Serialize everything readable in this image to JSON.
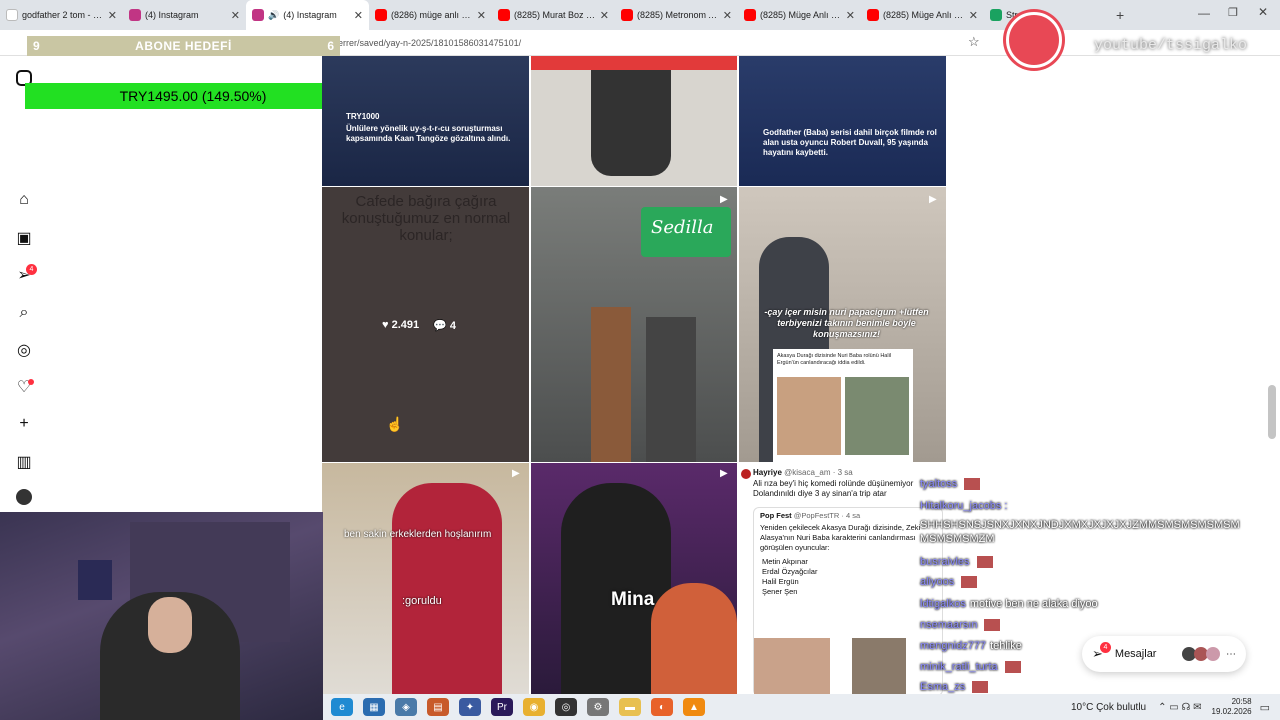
{
  "tabs": [
    {
      "title": "godfather 2 tom - Goog",
      "color": "#ffffff"
    },
    {
      "title": "(4) Instagram",
      "color": "#c13584"
    },
    {
      "title": "(4) Instagram",
      "color": "#c13584",
      "active": true
    },
    {
      "title": "(8286) müge anlı - YouTu",
      "color": "#ff0000"
    },
    {
      "title": "(8285) Murat Boz - Uçur",
      "color": "#ff0000"
    },
    {
      "title": "(8285) Metronom Akadı",
      "color": "#ff0000"
    },
    {
      "title": "(8285) Müge Anlı ile Tatl",
      "color": "#ff0000"
    },
    {
      "title": "(8285) Müge Anlı ile Tat",
      "color": "#ff0000"
    },
    {
      "title": "Stre",
      "color": "#1aa260"
    }
  ],
  "address": {
    "url": "errer/saved/yay-n-2025/18101586031475101/"
  },
  "overlay": {
    "abone_left": "9",
    "abone_title": "ABONE HEDEFİ",
    "abone_right": "6",
    "money": "TRY1495.00 (149.50%)",
    "yt_tag": "youtube/tssigalko"
  },
  "sidebar": {
    "badges": {
      "messages": "4"
    }
  },
  "posts": [
    {
      "headline": "Ünlülere yönelik uy-ş-t-r-cu soruşturması kapsamında Kaan Tangöze gözaltına alındı.",
      "tag": "TRY1000"
    },
    {
      "headline": "Godfather (Baba) serisi dahil birçok filmde rol alan usta oyuncu Robert Duvall, 95 yaşında hayatını kaybetti."
    },
    {
      "headline": "Cafede bağıra çağıra konuştuğumuz en normal konular;",
      "likes": "2.491",
      "comments": "4"
    },
    {
      "headline": "Sedilla"
    },
    {
      "headline": "-çay içer misin nuri papacigum +lütfen terbiyenizi takının benimle böyle konuşmazsınız!",
      "sub": "Akasya Durağı dizisinde Nuri Baba rolünü Halil Ergün'ün canlandıracağı iddia edildi."
    },
    {
      "headline": "ben sakin erkeklerden hoşlanırım",
      "sub": ":goruldu"
    },
    {
      "headline": "Mina"
    },
    {
      "tweet_user": "Hayriye",
      "tweet_handle": "@kisaca_am · 3 sa",
      "tweet_text": "Ali rıza bey'i hiç komedi rolünde düşünemiyor Dolandınıldı diye 3 ay sinan'a trip atar",
      "quote_user": "Pop Fest",
      "quote_handle": "@PopFestTR · 4 sa",
      "quote_text": "Yeniden çekilecek Akasya Durağı dizisinde, Zeki Alasya'nın Nuri Baba karakterini canlandırması görüşülen oyuncular:",
      "names": [
        "Metin Akpınar",
        "Erdal Özyağcılar",
        "Halil Ergün",
        "Şener Şen"
      ]
    }
  ],
  "chat": [
    {
      "user": "tyaltoss",
      "msg": ""
    },
    {
      "user": "Hitalkoru_jacobs :",
      "msg": ""
    },
    {
      "user": "",
      "msg": "SHHSHSNSJSNXJXNXJNDJXMXJXJXJXJZMMSMSMSMSMSM MSMSMSMZM"
    },
    {
      "user": "busraivles",
      "msg": ""
    },
    {
      "user": "aliyoos",
      "msg": ""
    },
    {
      "user": "ldtigalkos",
      "msg": "motive ben ne alaka diyoo"
    },
    {
      "user": "nsemaarsın",
      "msg": ""
    },
    {
      "user": "mengnidz777",
      "msg": "tehlike"
    },
    {
      "user": "minik_ratli_turta",
      "msg": ""
    },
    {
      "user": "Esma_zs",
      "msg": ""
    }
  ],
  "messages_widget": {
    "label": "Mesajlar",
    "count": "4"
  },
  "taskbar": {
    "weather": "10°C  Çok bulutlu",
    "time": "20:58",
    "date": "19.02.2026"
  }
}
